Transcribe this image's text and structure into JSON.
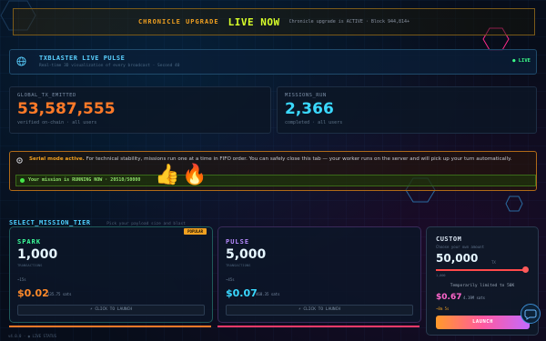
{
  "banner": {
    "label": "CHRONICLE UPGRADE",
    "status": "LIVE NOW",
    "note": "Chronicle upgrade is ACTIVE · Block 944,814+"
  },
  "pulse": {
    "title": "TXBLASTER LIVE PULSE",
    "subtitle": "Real-time 3D visualization of every broadcast · Second 40",
    "live": "● LIVE"
  },
  "stats": {
    "tx": {
      "label": "GLOBAL_TX_EMITTED",
      "value": "53,587,555",
      "caption": "verified on-chain · all users"
    },
    "missions": {
      "label": "MISSIONS_RUN",
      "value": "2,366",
      "caption": "completed · all users"
    }
  },
  "serial": {
    "lead": "Serial mode active.",
    "body": " For technical stability, missions run one at a time in FIFO order. You can safely close this tab — your worker runs on the server and will pick up your turn automatically.",
    "mission": "Your mission is RUNNING NOW · 20510/50000",
    "emoji1": "👍",
    "emoji2": "🔥"
  },
  "section": {
    "title": "SELECT_MISSION_TIER",
    "hint": "Pick your payload size and blast"
  },
  "tiers": [
    {
      "name": "SPARK",
      "count": "1,000",
      "unit": "TRANSACTIONS",
      "eta": "~15s",
      "price": "$0.02",
      "sats": "135.75 sats",
      "button": "⚡ CLICK TO LAUNCH",
      "badge": "POPULAR",
      "color": "#3cff9a"
    },
    {
      "name": "PULSE",
      "count": "5,000",
      "unit": "TRANSACTIONS",
      "eta": "~45s",
      "price": "$0.07",
      "sats": "468.35 sats",
      "button": "⚡ CLICK TO LAUNCH",
      "color": "#b78aff"
    }
  ],
  "custom": {
    "name": "CUSTOM",
    "hint": "Choose your own amount",
    "value": "50,000",
    "unit": "TX",
    "min": "1,000",
    "slider_fraction": 1.0,
    "limit": "Temporarily limited to 50K",
    "price": "$0.67",
    "sats": "4.19M sats",
    "eta": "~8m 5s",
    "launch": "LAUNCH"
  },
  "footer": "v4.0.0 · ◉ LIVE STATUS",
  "colors": {
    "accent": "#f0a020",
    "cyan": "#5ad0ff",
    "green": "#3cff8a"
  }
}
